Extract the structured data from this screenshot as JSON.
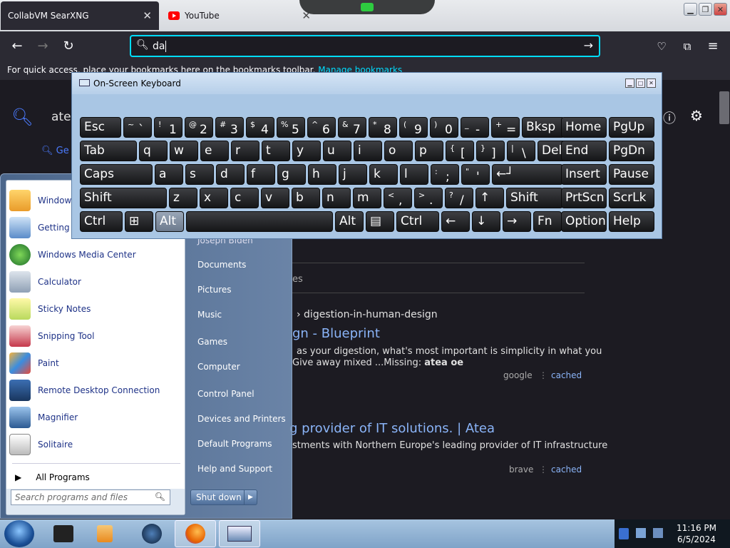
{
  "browser": {
    "tabs": [
      {
        "label": "CollabVM SearXNG"
      },
      {
        "label": "YouTube"
      }
    ],
    "url_value": "da",
    "bookmarks_text": "For quick access, place your bookmarks here on the bookmarks toolbar.",
    "bookmarks_link": "Manage bookmarks"
  },
  "page": {
    "search_value": "atea",
    "tab_label": "Ge",
    "frag_es": "es",
    "results": [
      {
        "breadcrumb": "› digestion-in-human-design",
        "title": "gn - Blueprint",
        "snippet1": "as your digestion, what's most important is simplicity in what you",
        "snippet2": "Give away mixed ...Missing:",
        "snippet_bold": "atea oe",
        "engine": "google",
        "cached": "cached"
      },
      {
        "title": "g provider of IT solutions. | Atea",
        "snippet1": "stments with Northern Europe's leading provider of IT infrastructure",
        "engine": "brave",
        "cached": "cached"
      }
    ]
  },
  "osk": {
    "title": "On-Screen Keyboard",
    "row1": [
      "Esc",
      "~ `",
      "! 1",
      "@ 2",
      "# 3",
      "$ 4",
      "% 5",
      "^ 6",
      "& 7",
      "* 8",
      "( 9",
      ") 0",
      "_ -",
      "+ =",
      "Bksp",
      "Home",
      "PgUp"
    ],
    "row2": [
      "Tab",
      "q",
      "w",
      "e",
      "r",
      "t",
      "y",
      "u",
      "i",
      "o",
      "p",
      "{ [",
      "} ]",
      "| \\",
      "Del",
      "End",
      "PgDn"
    ],
    "row3": [
      "Caps",
      "a",
      "s",
      "d",
      "f",
      "g",
      "h",
      "j",
      "k",
      "l",
      ": ;",
      "\" '",
      "←┘",
      "Insert",
      "Pause"
    ],
    "row4": [
      "Shift",
      "z",
      "x",
      "c",
      "v",
      "b",
      "n",
      "m",
      "< ,",
      "> .",
      "? /",
      "↑",
      "Shift",
      "PrtScn",
      "ScrLk"
    ],
    "row5": [
      "Ctrl",
      "⊞",
      "Alt",
      "",
      "Alt",
      "▤",
      "Ctrl",
      "←",
      "↓",
      "→",
      "Fn",
      "Options",
      "Help"
    ]
  },
  "start_menu": {
    "left_items": [
      "Windows",
      "Getting S",
      "Windows Media Center",
      "Calculator",
      "Sticky Notes",
      "Snipping Tool",
      "Paint",
      "Remote Desktop Connection",
      "Magnifier",
      "Solitaire"
    ],
    "all_programs": "All Programs",
    "search_placeholder": "Search programs and files",
    "user": "Joseph Biden",
    "right_items": [
      "Documents",
      "Pictures",
      "Music",
      "Games",
      "Computer",
      "Control Panel",
      "Devices and Printers",
      "Default Programs",
      "Help and Support"
    ],
    "shutdown": "Shut down"
  },
  "taskbar": {
    "time": "11:16 PM",
    "date": "6/5/2024"
  },
  "colors": {
    "accent": "#00ddff",
    "link": "#8ab4f8",
    "osk_bg": "#a9c6e4"
  }
}
